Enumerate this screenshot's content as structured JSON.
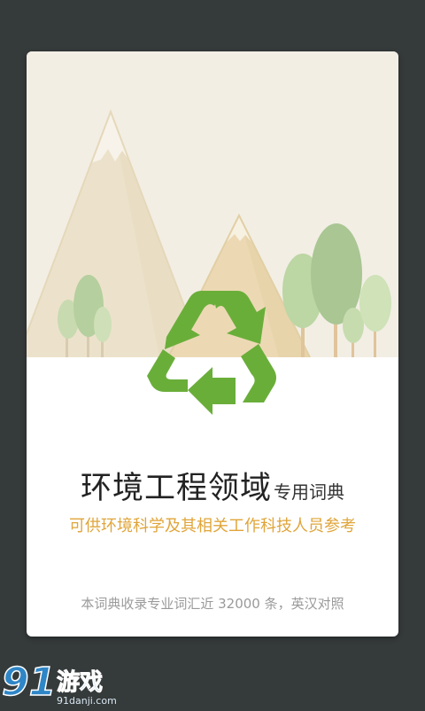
{
  "app": {
    "title_main": "环境工程领域",
    "title_suffix": "专用词典",
    "subtitle": "可供环境科学及其相关工作科技人员参考",
    "footnote": "本词典收录专业词汇近 32000 条，英汉对照"
  },
  "watermark": {
    "logo_text": "91游戏",
    "url_text": "91danji.com"
  },
  "colors": {
    "background": "#353a3a",
    "card": "#ffffff",
    "recycle_green": "#6aae3a",
    "subtitle_orange": "#e0a53a",
    "scene_sky": "#f2eee4",
    "mountain": "#ece2cc",
    "tree_green": "#b5cf9e"
  },
  "icons": {
    "recycle": "recycle-icon",
    "mountains": "mountain-illustration",
    "trees": "tree-illustration"
  }
}
